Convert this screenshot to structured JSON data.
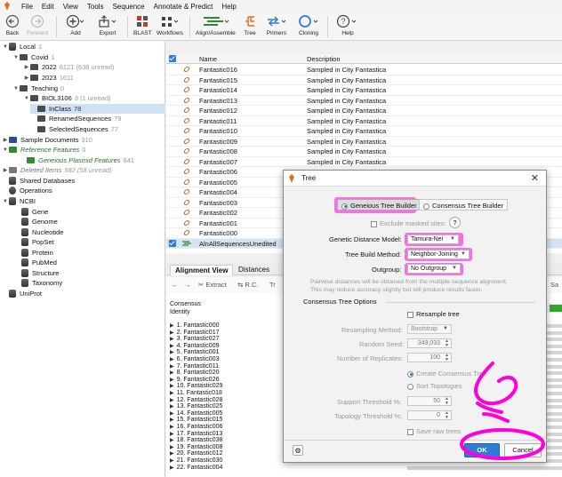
{
  "menu": {
    "items": [
      "File",
      "Edit",
      "View",
      "Tools",
      "Sequence",
      "Annotate & Predict",
      "Help"
    ]
  },
  "toolbar": {
    "back": "Back",
    "forward": "Forward",
    "add": "Add",
    "export": "Export",
    "blast": "BLAST",
    "workflows": "Workflows",
    "align": "Align/Assemble",
    "tree": "Tree",
    "primers": "Primers",
    "cloning": "Cloning",
    "help": "Help"
  },
  "sidebar": {
    "local": "Local",
    "local_count": "1",
    "covid": "Covid",
    "covid_count": "1",
    "y2022": "2022",
    "y2022_count": "6121 (638 unread)",
    "y2023": "2023",
    "y2023_count": "1611",
    "teaching": "Teaching",
    "teaching_count": "0",
    "biol": "BIOL3106",
    "biol_count": "3 (1 unread)",
    "inclass": "InClass",
    "inclass_count": "78",
    "renamed": "RenamedSequences",
    "renamed_count": "79",
    "selected": "SelectedSequences",
    "selected_count": "77",
    "sampledocs": "Sample Documents",
    "sampledocs_count": "310",
    "reffeatures": "Reference Features",
    "reffeatures_count": "0",
    "plasmid": "Geneious Plasmid Features",
    "plasmid_count": "841",
    "deleted": "Deleted Items",
    "deleted_count": "982 (58 unread)",
    "shared": "Shared Databases",
    "operations": "Operations",
    "ncbi": "NCBI",
    "gene": "Gene",
    "genome": "Genome",
    "nucleotide": "Nucleotide",
    "popset": "PopSet",
    "protein": "Protein",
    "pubmed": "PubMed",
    "structure": "Structure",
    "taxonomy": "Taxonomy",
    "uniprot": "UniProt"
  },
  "table": {
    "col_name": "Name",
    "col_desc": "Description",
    "rows": [
      {
        "name": "Fantastic016",
        "desc": "Sampled in City Fantastica"
      },
      {
        "name": "Fantastic015",
        "desc": "Sampled in City Fantastica"
      },
      {
        "name": "Fantastic014",
        "desc": "Sampled in City Fantastica"
      },
      {
        "name": "Fantastic013",
        "desc": "Sampled in City Fantastica"
      },
      {
        "name": "Fantastic012",
        "desc": "Sampled in City Fantastica"
      },
      {
        "name": "Fantastic011",
        "desc": "Sampled in City Fantastica"
      },
      {
        "name": "Fantastic010",
        "desc": "Sampled in City Fantastica"
      },
      {
        "name": "Fantastic009",
        "desc": "Sampled in City Fantastica"
      },
      {
        "name": "Fantastic008",
        "desc": "Sampled in City Fantastica"
      },
      {
        "name": "Fantastic007",
        "desc": "Sampled in City Fantastica"
      },
      {
        "name": "Fantastic006",
        "desc": ""
      },
      {
        "name": "Fantastic005",
        "desc": ""
      },
      {
        "name": "Fantastic004",
        "desc": ""
      },
      {
        "name": "Fantastic003",
        "desc": ""
      },
      {
        "name": "Fantastic002",
        "desc": ""
      },
      {
        "name": "Fantastic001",
        "desc": ""
      },
      {
        "name": "Fantastic000",
        "desc": ""
      },
      {
        "name": "AlnAllSequencesUnedited",
        "desc": ""
      }
    ]
  },
  "viewer": {
    "tab_alignment": "Alignment View",
    "tab_distances": "Distances",
    "extract": "Extract",
    "rc": "R.C.",
    "tr": "Tr",
    "sa": "Sa",
    "consensus": "Consensus",
    "identity": "Identity",
    "seqs": [
      "1. Fantastic000",
      "2. Fantastic017",
      "3. Fantastic027",
      "4. Fantastic009",
      "5. Fantastic001",
      "6. Fantastic003",
      "7. Fantastic011",
      "8. Fantastic020",
      "9. Fantastic026",
      "10. Fantastic029",
      "11. Fantastic018",
      "12. Fantastic028",
      "13. Fantastic025",
      "14. Fantastic005",
      "15. Fantastic015",
      "16. Fantastic006",
      "17. Fantastic013",
      "18. Fantastic038",
      "19. Fantastic008",
      "20. Fantastic012",
      "21. Fantastic030",
      "22. Fantastic004"
    ]
  },
  "dialog": {
    "title": "Tree",
    "builder_geneious": "Geneious Tree Builder",
    "builder_consensus": "Consensus Tree Builder",
    "exclude_masked": "Exclude masked sites:",
    "help_q": "?",
    "distance_label": "Genetic Distance Model:",
    "distance_value": "Tamura-Nei",
    "method_label": "Tree Build Method:",
    "method_value": "Neighbor-Joining",
    "outgroup_label": "Outgroup:",
    "outgroup_value": "No Outgroup",
    "info_line1": "Pairwise distances will be obtained from the multiple sequence alignment.",
    "info_line2": "This may reduce accuracy slightly but will produce results faster.",
    "consensus_section": "Consensus Tree Options",
    "resample": "Resample tree",
    "resampling_label": "Resampling Method:",
    "resampling_value": "Bootstrap",
    "seed_label": "Random Seed:",
    "seed_value": "349,033",
    "replicates_label": "Number of Replicates:",
    "replicates_value": "100",
    "create_consensus": "Create Consensus Tree",
    "sort_topologies": "Sort Topologies",
    "support_label": "Support Threshold %:",
    "support_value": "50",
    "topology_label": "Topology Threshold %:",
    "topology_value": "0",
    "save_raw": "Save raw trees",
    "ok": "OK",
    "cancel": "Cancel"
  },
  "colors": {
    "accent": "#2d7cd6",
    "highlight": "#ff00dc",
    "selection": "#cfe1f5"
  }
}
